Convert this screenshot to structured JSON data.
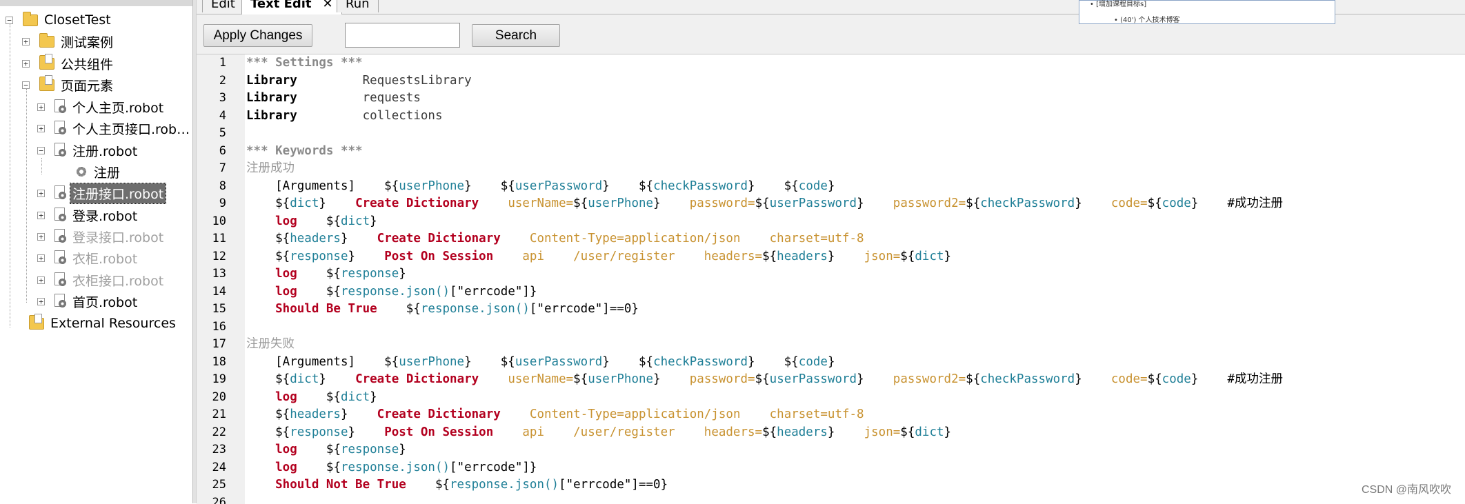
{
  "tree": {
    "root": {
      "label": "ClosetTest"
    },
    "items": [
      {
        "label": "测试案例",
        "icon": "folder-icon",
        "state": "normal"
      },
      {
        "label": "公共组件",
        "icon": "folder-icon",
        "state": "normal"
      },
      {
        "label": "页面元素",
        "icon": "folder-icon",
        "state": "normal"
      },
      {
        "label": "个人主页.robot",
        "icon": "file-gear-icon",
        "state": "normal"
      },
      {
        "label": "个人主页接口.rob…",
        "icon": "file-gear-icon",
        "state": "normal"
      },
      {
        "label": "注册.robot",
        "icon": "file-gear-icon",
        "state": "normal"
      },
      {
        "label": "注册",
        "icon": "gear-icon",
        "state": "normal"
      },
      {
        "label": "注册接口.robot",
        "icon": "file-gear-icon",
        "state": "selected"
      },
      {
        "label": "登录.robot",
        "icon": "file-gear-icon",
        "state": "normal"
      },
      {
        "label": "登录接口.robot",
        "icon": "file-gear-icon",
        "state": "disabled"
      },
      {
        "label": "衣柜.robot",
        "icon": "file-gear-icon",
        "state": "disabled"
      },
      {
        "label": "衣柜接口.robot",
        "icon": "file-gear-icon",
        "state": "disabled"
      },
      {
        "label": "首页.robot",
        "icon": "file-gear-icon",
        "state": "normal"
      },
      {
        "label": "External Resources",
        "icon": "folder-icon",
        "state": "normal"
      }
    ]
  },
  "tabs": [
    {
      "label": "Edit"
    },
    {
      "label": "Text Edit",
      "close": "✕"
    },
    {
      "label": "Run"
    }
  ],
  "toolbar": {
    "apply_label": "Apply Changes",
    "search_label": "Search",
    "search_value": ""
  },
  "popup": {
    "line1": "• [增加课程目标s]",
    "line2": "• (40') 个人技术博客"
  },
  "code_lines": [
    {
      "n": "1",
      "t": [
        [
          "header",
          "*** Settings ***"
        ]
      ]
    },
    {
      "n": "2",
      "t": [
        [
          "kw",
          "Library"
        ],
        [
          "plain",
          "         RequestsLibrary"
        ]
      ]
    },
    {
      "n": "3",
      "t": [
        [
          "kw",
          "Library"
        ],
        [
          "plain",
          "         requests"
        ]
      ]
    },
    {
      "n": "4",
      "t": [
        [
          "kw",
          "Library"
        ],
        [
          "plain",
          "         collections"
        ]
      ]
    },
    {
      "n": "5",
      "t": []
    },
    {
      "n": "6",
      "t": [
        [
          "header",
          "*** Keywords ***"
        ]
      ]
    },
    {
      "n": "7",
      "t": [
        [
          "name",
          "注册成功"
        ]
      ]
    },
    {
      "n": "8",
      "t": [
        [
          "arg",
          "    [Arguments]    ${"
        ],
        [
          "var",
          "userPhone"
        ],
        [
          "arg",
          "}    ${"
        ],
        [
          "var",
          "userPassword"
        ],
        [
          "arg",
          "}    ${"
        ],
        [
          "var",
          "checkPassword"
        ],
        [
          "arg",
          "}    ${"
        ],
        [
          "var",
          "code"
        ],
        [
          "arg",
          "}"
        ]
      ]
    },
    {
      "n": "9",
      "t": [
        [
          "arg",
          "    ${"
        ],
        [
          "var",
          "dict"
        ],
        [
          "arg",
          "}    "
        ],
        [
          "fn",
          "Create Dictionary"
        ],
        [
          "named",
          "    userName="
        ],
        [
          "arg",
          "${"
        ],
        [
          "var",
          "userPhone"
        ],
        [
          "arg",
          "}"
        ],
        [
          "named",
          "    password="
        ],
        [
          "arg",
          "${"
        ],
        [
          "var",
          "userPassword"
        ],
        [
          "arg",
          "}"
        ],
        [
          "named",
          "    password2="
        ],
        [
          "arg",
          "${"
        ],
        [
          "var",
          "checkPassword"
        ],
        [
          "arg",
          "}"
        ],
        [
          "named",
          "    code="
        ],
        [
          "arg",
          "${"
        ],
        [
          "var",
          "code"
        ],
        [
          "arg",
          "}"
        ],
        [
          "comment",
          "    #成功注册"
        ]
      ]
    },
    {
      "n": "10",
      "t": [
        [
          "fn",
          "    log"
        ],
        [
          "arg",
          "    ${"
        ],
        [
          "var",
          "dict"
        ],
        [
          "arg",
          "}"
        ]
      ]
    },
    {
      "n": "11",
      "t": [
        [
          "arg",
          "    ${"
        ],
        [
          "var",
          "headers"
        ],
        [
          "arg",
          "}    "
        ],
        [
          "fn",
          "Create Dictionary"
        ],
        [
          "named",
          "    Content-Type=application/json    charset=utf-8"
        ]
      ]
    },
    {
      "n": "12",
      "t": [
        [
          "arg",
          "    ${"
        ],
        [
          "var",
          "response"
        ],
        [
          "arg",
          "}    "
        ],
        [
          "fn",
          "Post On Session"
        ],
        [
          "named",
          "    api    /user/register    headers="
        ],
        [
          "arg",
          "${"
        ],
        [
          "var",
          "headers"
        ],
        [
          "arg",
          "}"
        ],
        [
          "named",
          "    json="
        ],
        [
          "arg",
          "${"
        ],
        [
          "var",
          "dict"
        ],
        [
          "arg",
          "}"
        ]
      ]
    },
    {
      "n": "13",
      "t": [
        [
          "fn",
          "    log"
        ],
        [
          "arg",
          "    ${"
        ],
        [
          "var",
          "response"
        ],
        [
          "arg",
          "}"
        ]
      ]
    },
    {
      "n": "14",
      "t": [
        [
          "fn",
          "    log"
        ],
        [
          "arg",
          "    ${"
        ],
        [
          "var",
          "response.json()"
        ],
        [
          "arg",
          "[\"errcode\"]}"
        ]
      ]
    },
    {
      "n": "15",
      "t": [
        [
          "fn",
          "    Should Be True"
        ],
        [
          "arg",
          "    ${"
        ],
        [
          "var",
          "response.json()"
        ],
        [
          "arg",
          "[\"errcode\"]==0}"
        ]
      ]
    },
    {
      "n": "16",
      "t": []
    },
    {
      "n": "17",
      "t": [
        [
          "name",
          "注册失败"
        ]
      ]
    },
    {
      "n": "18",
      "t": [
        [
          "arg",
          "    [Arguments]    ${"
        ],
        [
          "var",
          "userPhone"
        ],
        [
          "arg",
          "}    ${"
        ],
        [
          "var",
          "userPassword"
        ],
        [
          "arg",
          "}    ${"
        ],
        [
          "var",
          "checkPassword"
        ],
        [
          "arg",
          "}    ${"
        ],
        [
          "var",
          "code"
        ],
        [
          "arg",
          "}"
        ]
      ]
    },
    {
      "n": "19",
      "t": [
        [
          "arg",
          "    ${"
        ],
        [
          "var",
          "dict"
        ],
        [
          "arg",
          "}    "
        ],
        [
          "fn",
          "Create Dictionary"
        ],
        [
          "named",
          "    userName="
        ],
        [
          "arg",
          "${"
        ],
        [
          "var",
          "userPhone"
        ],
        [
          "arg",
          "}"
        ],
        [
          "named",
          "    password="
        ],
        [
          "arg",
          "${"
        ],
        [
          "var",
          "userPassword"
        ],
        [
          "arg",
          "}"
        ],
        [
          "named",
          "    password2="
        ],
        [
          "arg",
          "${"
        ],
        [
          "var",
          "checkPassword"
        ],
        [
          "arg",
          "}"
        ],
        [
          "named",
          "    code="
        ],
        [
          "arg",
          "${"
        ],
        [
          "var",
          "code"
        ],
        [
          "arg",
          "}"
        ],
        [
          "comment",
          "    #成功注册"
        ]
      ]
    },
    {
      "n": "20",
      "t": [
        [
          "fn",
          "    log"
        ],
        [
          "arg",
          "    ${"
        ],
        [
          "var",
          "dict"
        ],
        [
          "arg",
          "}"
        ]
      ]
    },
    {
      "n": "21",
      "t": [
        [
          "arg",
          "    ${"
        ],
        [
          "var",
          "headers"
        ],
        [
          "arg",
          "}    "
        ],
        [
          "fn",
          "Create Dictionary"
        ],
        [
          "named",
          "    Content-Type=application/json    charset=utf-8"
        ]
      ]
    },
    {
      "n": "22",
      "t": [
        [
          "arg",
          "    ${"
        ],
        [
          "var",
          "response"
        ],
        [
          "arg",
          "}    "
        ],
        [
          "fn",
          "Post On Session"
        ],
        [
          "named",
          "    api    /user/register    headers="
        ],
        [
          "arg",
          "${"
        ],
        [
          "var",
          "headers"
        ],
        [
          "arg",
          "}"
        ],
        [
          "named",
          "    json="
        ],
        [
          "arg",
          "${"
        ],
        [
          "var",
          "dict"
        ],
        [
          "arg",
          "}"
        ]
      ]
    },
    {
      "n": "23",
      "t": [
        [
          "fn",
          "    log"
        ],
        [
          "arg",
          "    ${"
        ],
        [
          "var",
          "response"
        ],
        [
          "arg",
          "}"
        ]
      ]
    },
    {
      "n": "24",
      "t": [
        [
          "fn",
          "    log"
        ],
        [
          "arg",
          "    ${"
        ],
        [
          "var",
          "response.json()"
        ],
        [
          "arg",
          "[\"errcode\"]}"
        ]
      ]
    },
    {
      "n": "25",
      "t": [
        [
          "fn",
          "    Should Not Be True"
        ],
        [
          "arg",
          "    ${"
        ],
        [
          "var",
          "response.json()"
        ],
        [
          "arg",
          "[\"errcode\"]==0}"
        ]
      ]
    },
    {
      "n": "26",
      "t": []
    }
  ],
  "watermark": "CSDN @南风吹吹"
}
